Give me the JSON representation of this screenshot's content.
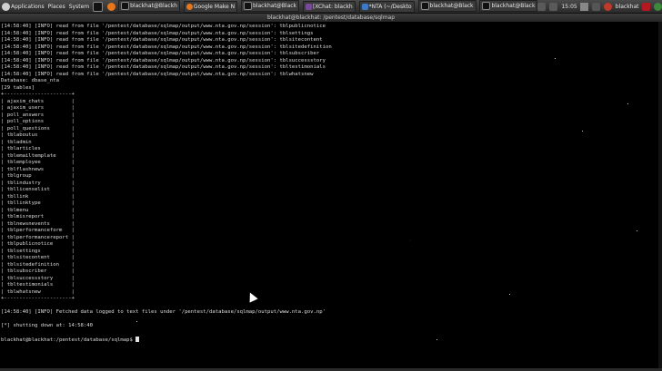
{
  "panel": {
    "applications": "Applications",
    "places": "Places",
    "system": "System",
    "tasks": [
      {
        "label": "blackhat@Blackh",
        "color": "#222"
      },
      {
        "label": "Google Make N",
        "color": "#e8761a"
      },
      {
        "label": "blackhat@Black",
        "color": "#222"
      },
      {
        "label": "[XChat: blackh",
        "color": "#7a4a9a"
      },
      {
        "label": "*NTA (~/Deskto",
        "color": "#3b7ac9"
      },
      {
        "label": "blackhat@Black",
        "color": "#222"
      },
      {
        "label": "blackhat@Black",
        "color": "#222"
      }
    ],
    "clock": "15:05",
    "user": "blackhat"
  },
  "terminal": {
    "title": "blackhat@blackhat: /pentest/database/sqlmap",
    "lines": [
      "[14:58:40] [INFO] read from file '/pentest/database/sqlmap/output/www.nta.gov.np/session': tblpublicnotice",
      "[14:58:40] [INFO] read from file '/pentest/database/sqlmap/output/www.nta.gov.np/session': tblsettings",
      "[14:58:40] [INFO] read from file '/pentest/database/sqlmap/output/www.nta.gov.np/session': tblsitecontent",
      "[14:58:40] [INFO] read from file '/pentest/database/sqlmap/output/www.nta.gov.np/session': tblsitedefinition",
      "[14:58:40] [INFO] read from file '/pentest/database/sqlmap/output/www.nta.gov.np/session': tblsubscriber",
      "[14:58:40] [INFO] read from file '/pentest/database/sqlmap/output/www.nta.gov.np/session': tblsuccessstory",
      "[14:58:40] [INFO] read from file '/pentest/database/sqlmap/output/www.nta.gov.np/session': tbltestimonials",
      "[14:58:40] [INFO] read from file '/pentest/database/sqlmap/output/www.nta.gov.np/session': tblwhatsnew",
      "Database: dbase_nta",
      "[29 tables]",
      "+----------------------+",
      "| ajaxim_chats         |",
      "| ajaxim_users         |",
      "| poll_answers         |",
      "| poll_options         |",
      "| poll_questions       |",
      "| tblaboutus           |",
      "| tbladmin             |",
      "| tblarticles          |",
      "| tblemailtemplate     |",
      "| tblemployee          |",
      "| tblflashnews         |",
      "| tblgroup             |",
      "| tblindustry          |",
      "| tbllicenselist       |",
      "| tbllink              |",
      "| tbllinktype          |",
      "| tblmenu              |",
      "| tblmisreport         |",
      "| tblnewsnevents       |",
      "| tblperformanceform   |",
      "| tblperformancereport |",
      "| tblpublicnotice      |",
      "| tblsettings          |",
      "| tblsitecontent       |",
      "| tblsitedefinition    |",
      "| tblsubscriber        |",
      "| tblsuccessstory      |",
      "| tbltestimonials      |",
      "| tblwhatsnew          |",
      "+----------------------+",
      "",
      "[14:58:40] [INFO] Fetched data logged to text files under '/pentest/database/sqlmap/output/www.nta.gov.np'",
      "",
      "[*] shutting down at: 14:58:40",
      "",
      "blackhat@blackhat:/pentest/database/sqlmap$ "
    ]
  }
}
